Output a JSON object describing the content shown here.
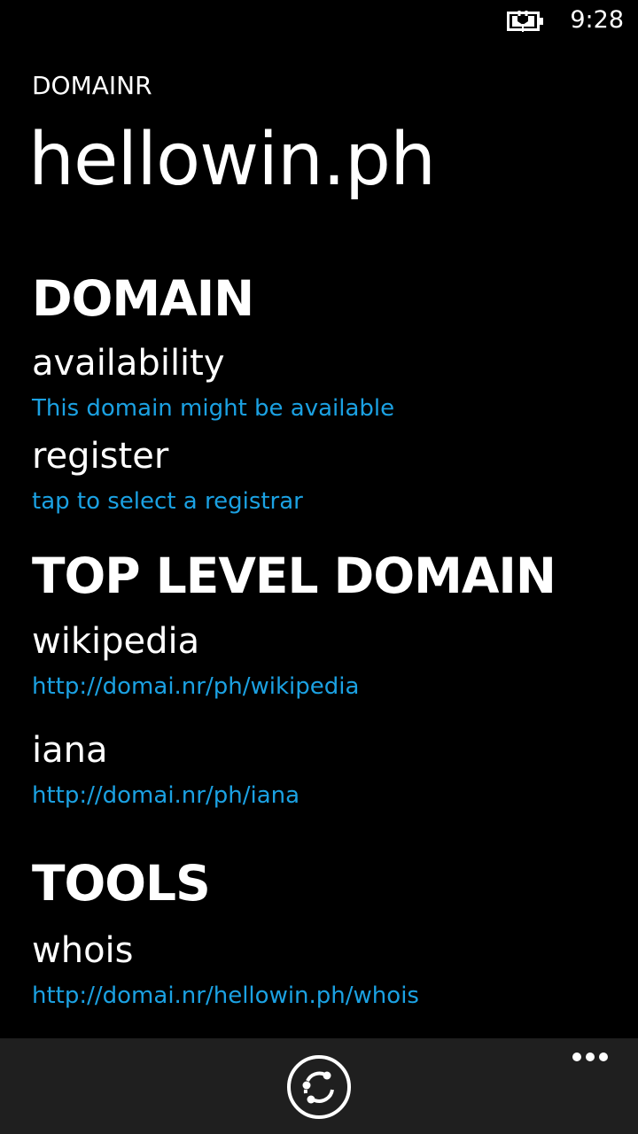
{
  "status_bar": {
    "time": "9:28",
    "battery_icon": "battery-charging-icon"
  },
  "header": {
    "app_name": "DOMAINR",
    "title": "hellowin.ph"
  },
  "sections": {
    "domain": {
      "header": "DOMAIN",
      "availability": {
        "label": "availability",
        "value": "This domain might be available"
      },
      "register": {
        "label": "register",
        "value": "tap to select a registrar"
      }
    },
    "tld": {
      "header": "TOP LEVEL DOMAIN",
      "wikipedia": {
        "label": "wikipedia",
        "value": "http://domai.nr/ph/wikipedia"
      },
      "iana": {
        "label": "iana",
        "value": "http://domai.nr/ph/iana"
      }
    },
    "tools": {
      "header": "TOOLS",
      "whois": {
        "label": "whois",
        "value": "http://domai.nr/hellowin.ph/whois"
      }
    }
  },
  "app_bar": {
    "refresh_icon": "refresh-icon",
    "more_icon": "more-icon"
  },
  "colors": {
    "background": "#000000",
    "accent": "#1ba1e2",
    "app_bar": "#1f1f1f",
    "text": "#ffffff"
  }
}
